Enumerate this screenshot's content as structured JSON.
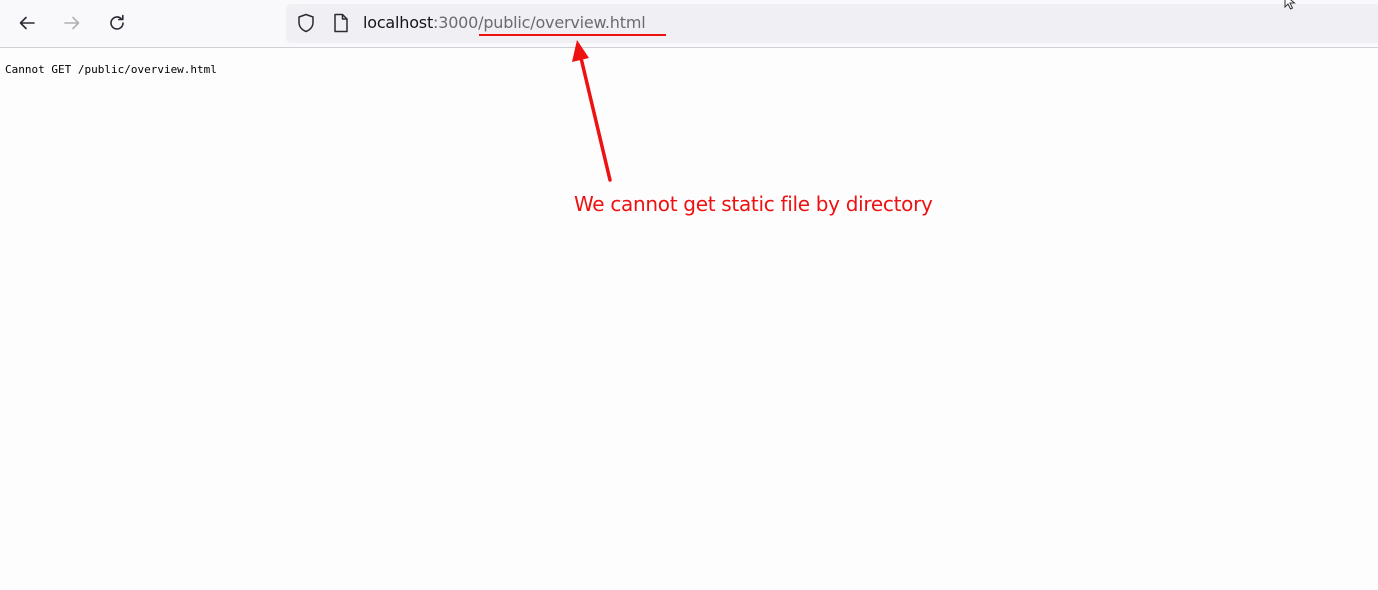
{
  "browser": {
    "url_host": "localhost",
    "url_rest": ":3000/public/overview.html"
  },
  "page": {
    "body_text": "Cannot GET /public/overview.html"
  },
  "annotation": {
    "text": "We cannot get static file by directory",
    "color": "#ee1111"
  },
  "icons": {
    "back": "arrow-left-icon",
    "forward": "arrow-right-icon",
    "reload": "reload-icon",
    "tracking": "shield-icon",
    "page": "page-icon",
    "cursor": "mouse-cursor-icon"
  }
}
